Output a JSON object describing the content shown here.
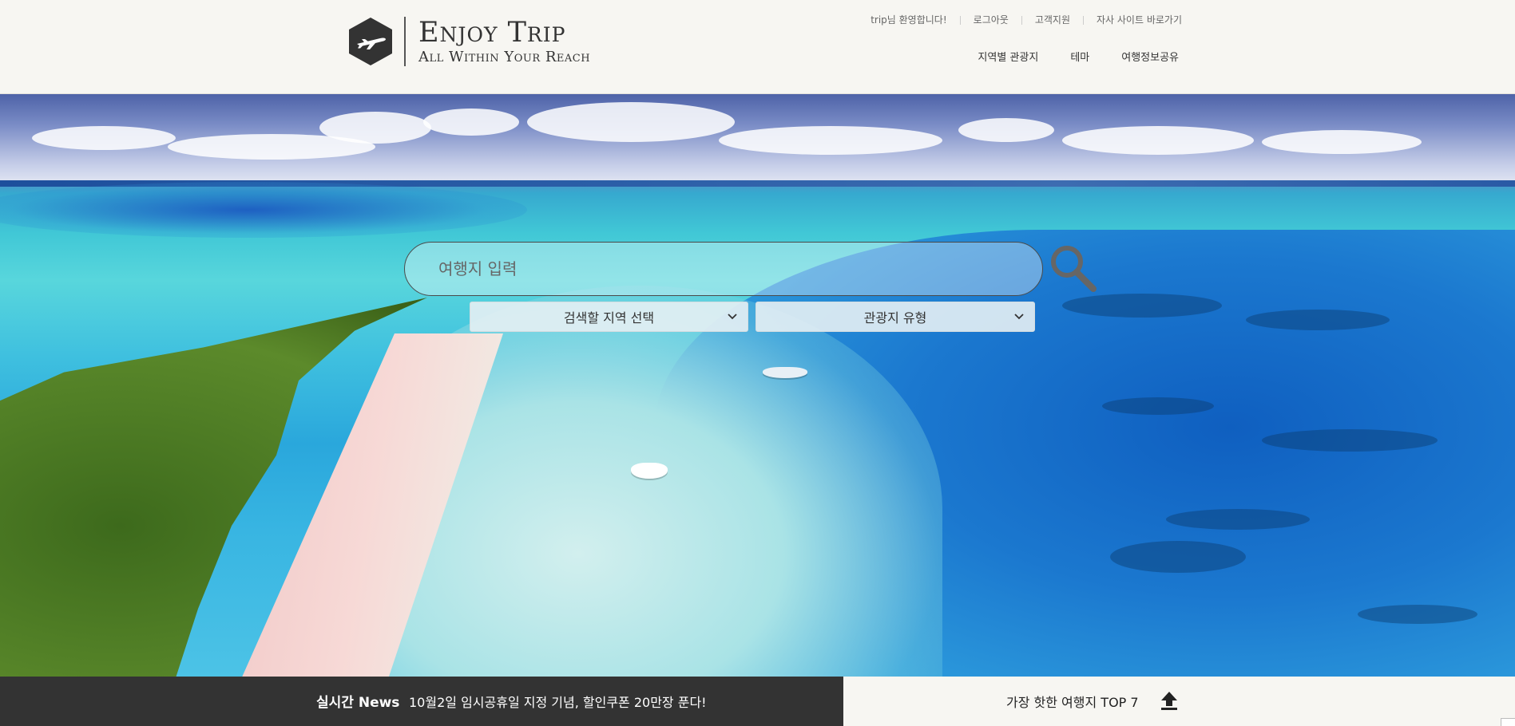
{
  "header": {
    "logo_title": "Enjoy Trip",
    "logo_subtitle": "All Within Your Reach",
    "util_nav": [
      "trip님 환영합니다!",
      "로그아웃",
      "고객지원",
      "자사 사이트 바로가기"
    ],
    "main_nav": [
      "지역별 관광지",
      "테마",
      "여행정보공유"
    ]
  },
  "search": {
    "placeholder": "여행지 입력",
    "region_select": "검색할 지역 선택",
    "type_select": "관광지 유형"
  },
  "news": {
    "label": "실시간 News",
    "text": "10월2일 임시공휴일 지정 기념, 할인쿠폰 20만장 푼다!"
  },
  "top7": {
    "label": "가장 핫한 여행지 TOP 7"
  },
  "colors": {
    "header_bg": "#f7f6f2",
    "news_bg": "#333333",
    "logo_hex": "#333333"
  }
}
